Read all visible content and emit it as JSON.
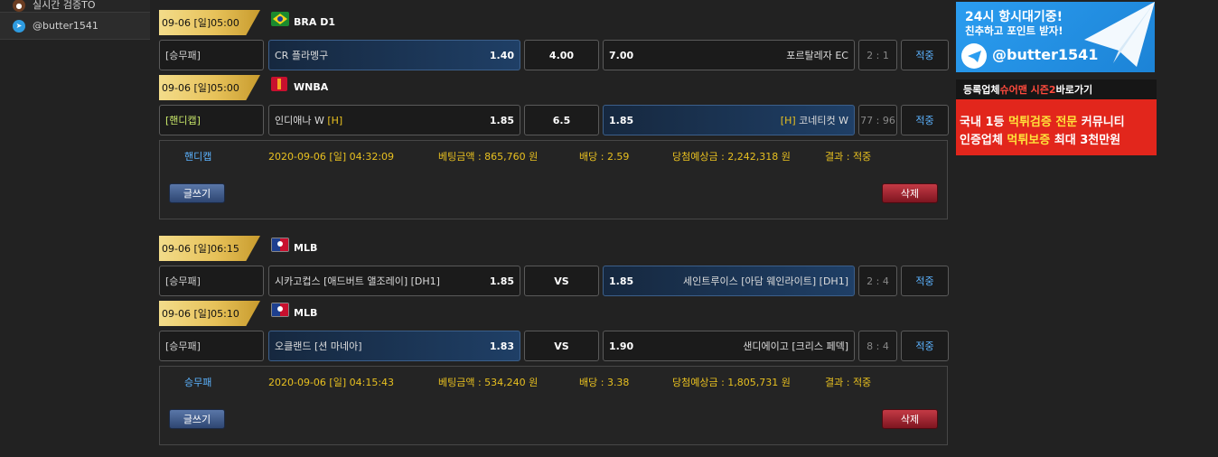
{
  "sidebar": {
    "items": [
      {
        "label": "실시간 검증TO",
        "icon": "user-icon"
      },
      {
        "label": "@butter1541",
        "icon": "telegram-icon"
      }
    ]
  },
  "bets": [
    {
      "matches": [
        {
          "date": "09-06 [일]05:00",
          "league": "BRA D1",
          "league_icon": "brazil-flag-icon",
          "bet_type": "[승무패]",
          "home_team": "CR 플라멩구",
          "home_mark": "",
          "home_odd": "1.40",
          "mid": "4.00",
          "away_odd": "7.00",
          "away_team": "포르탈레자 EC",
          "away_mark": "",
          "score": "2 : 1",
          "result": "적중",
          "selected": "home"
        },
        {
          "date": "09-06 [일]05:00",
          "league": "WNBA",
          "league_icon": "wnba-logo-icon",
          "bet_type": "[핸디캡]",
          "home_team": "인디애나 W",
          "home_mark": "[H]",
          "home_odd": "1.85",
          "mid": "6.5",
          "away_odd": "1.85",
          "away_team": "코네티컷 W",
          "away_mark": "[H]",
          "score": "77 : 96",
          "result": "적중",
          "selected": "away"
        }
      ],
      "summary": {
        "type": "핸디캡",
        "date": "2020-09-06 [일] 04:32:09",
        "amount": "베팅금액 : 865,760 원",
        "odds": "배당 : 2.59",
        "expected": "당첨예상금 : 2,242,318 원",
        "result": "결과 : 적중",
        "write": "글쓰기",
        "delete": "삭제"
      }
    },
    {
      "matches": [
        {
          "date": "09-06 [일]06:15",
          "league": "MLB",
          "league_icon": "mlb-logo-icon",
          "bet_type": "[승무패]",
          "home_team": "시카고컵스 [애드버트 앨조레이] [DH1]",
          "home_mark": "",
          "home_odd": "1.85",
          "mid": "VS",
          "away_odd": "1.85",
          "away_team": "세인트루이스 [아담 웨인라이트] [DH1]",
          "away_mark": "",
          "score": "2 : 4",
          "result": "적중",
          "selected": "away"
        },
        {
          "date": "09-06 [일]05:10",
          "league": "MLB",
          "league_icon": "mlb-logo-icon",
          "bet_type": "[승무패]",
          "home_team": "오클랜드 [션 마네아]",
          "home_mark": "",
          "home_odd": "1.83",
          "mid": "VS",
          "away_odd": "1.90",
          "away_team": "샌디에이고 [크리스 페덱]",
          "away_mark": "",
          "score": "8 : 4",
          "result": "적중",
          "selected": "home"
        }
      ],
      "summary": {
        "type": "승무패",
        "date": "2020-09-06 [일] 04:15:43",
        "amount": "베팅금액 : 534,240 원",
        "odds": "배당 : 3.38",
        "expected": "당첨예상금 : 1,805,731 원",
        "result": "결과 : 적중",
        "write": "글쓰기",
        "delete": "삭제"
      }
    }
  ],
  "banners": {
    "telegram": {
      "title": "24시 항시대기중!",
      "subtitle": "친추하고 포인트 받자!",
      "handle": "@butter1541",
      "icon": "telegram-plane-icon"
    },
    "registration": {
      "top_prefix": "등록업체 ",
      "top_accent": "슈어맨 시즌2",
      "top_suffix": " 바로가기",
      "line1_a": "국내 1등 ",
      "line1_b": "먹튀검증 전문",
      "line1_c": " 커뮤니티",
      "line2_a": "인증업체 ",
      "line2_b": "먹튀보증",
      "line2_c": " 최대 3천만원"
    }
  },
  "colors": {
    "background": "#222222",
    "gold": "#e7c25a",
    "result_blue": "#5cb3ff",
    "summary_yellow": "#e8c020",
    "delete_red": "#c43a45",
    "telegram_blue": "#2b9df0",
    "banner_red": "#e2261c"
  }
}
